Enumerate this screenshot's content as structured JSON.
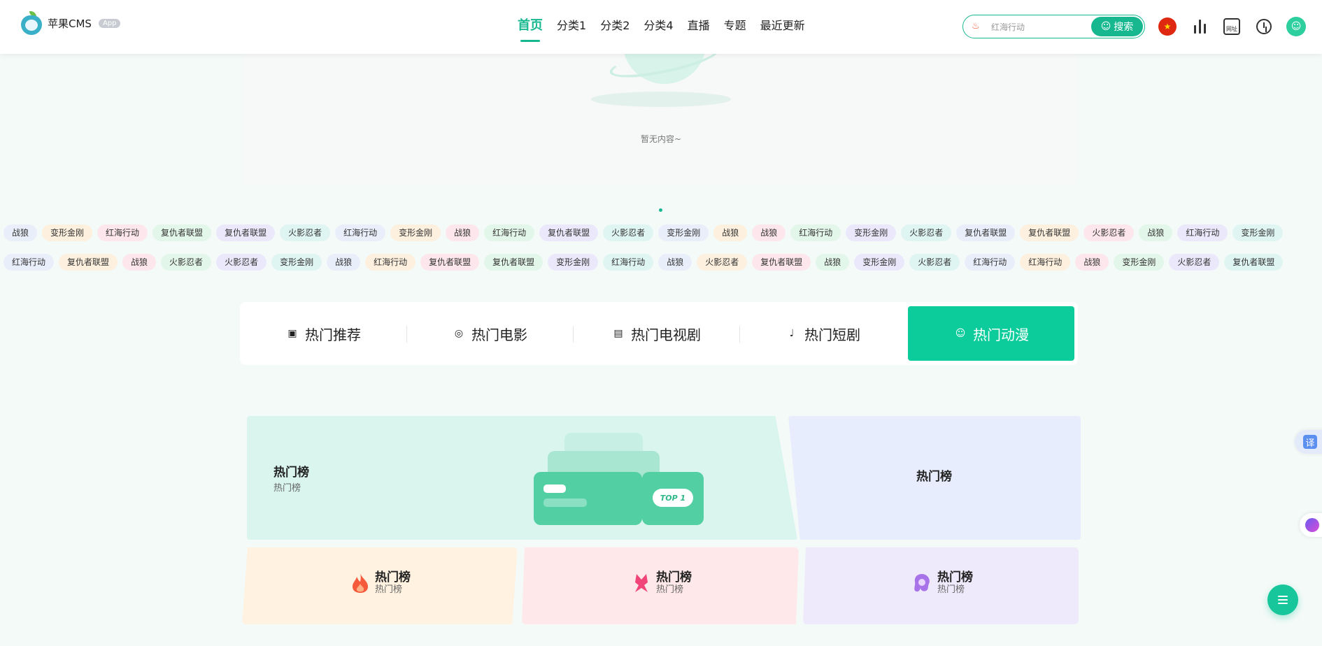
{
  "header": {
    "logo_text": "苹果CMS",
    "logo_badge": "App",
    "nav": [
      {
        "label": "首页",
        "active": true
      },
      {
        "label": "分类1"
      },
      {
        "label": "分类2"
      },
      {
        "label": "分类4"
      },
      {
        "label": "直播"
      },
      {
        "label": "专题"
      },
      {
        "label": "最近更新"
      }
    ],
    "search": {
      "value": "红海行动",
      "button": "搜索"
    },
    "web_label": "网址"
  },
  "empty": {
    "text": "暂无内容~"
  },
  "tags_row1": [
    "战狼",
    "变形金刚",
    "红海行动",
    "复仇者联盟",
    "复仇者联盟",
    "火影忍者",
    "红海行动",
    "变形金刚",
    "战狼",
    "红海行动",
    "复仇者联盟",
    "火影忍者",
    "变形金刚",
    "战狼",
    "战狼",
    "红海行动",
    "变形金刚",
    "火影忍者",
    "复仇者联盟",
    "复仇者联盟",
    "火影忍者",
    "战狼",
    "红海行动",
    "变形金刚"
  ],
  "tags_row2": [
    "红海行动",
    "复仇者联盟",
    "战狼",
    "火影忍者",
    "火影忍者",
    "变形金刚",
    "战狼",
    "红海行动",
    "复仇者联盟",
    "复仇者联盟",
    "变形金刚",
    "红海行动",
    "战狼",
    "火影忍者",
    "复仇者联盟",
    "战狼",
    "变形金刚",
    "火影忍者",
    "红海行动",
    "红海行动",
    "战狼",
    "变形金刚",
    "火影忍者",
    "复仇者联盟"
  ],
  "tabs": [
    {
      "label": "热门推荐",
      "icon": "video-camera-icon"
    },
    {
      "label": "热门电影",
      "icon": "film-reel-icon"
    },
    {
      "label": "热门电视剧",
      "icon": "tv-icon"
    },
    {
      "label": "热门短剧",
      "icon": "microphone-icon"
    },
    {
      "label": "热门动漫",
      "icon": "cartoon-face-icon",
      "active": true
    }
  ],
  "rank_cards": {
    "big": {
      "title": "热门榜",
      "subtitle": "热门榜",
      "badge": "TOP 1"
    },
    "right": {
      "title": "热门榜"
    },
    "small": [
      {
        "title": "热门榜",
        "subtitle": "热门榜",
        "icon": "flame-icon"
      },
      {
        "title": "热门榜",
        "subtitle": "热门榜",
        "icon": "bow-icon"
      },
      {
        "title": "热门榜",
        "subtitle": "热门榜",
        "icon": "girl-icon"
      }
    ]
  },
  "side": {
    "translate_label": "译"
  },
  "colors": {
    "accent": "#17b890",
    "tab_active": "#0ccc9c"
  }
}
